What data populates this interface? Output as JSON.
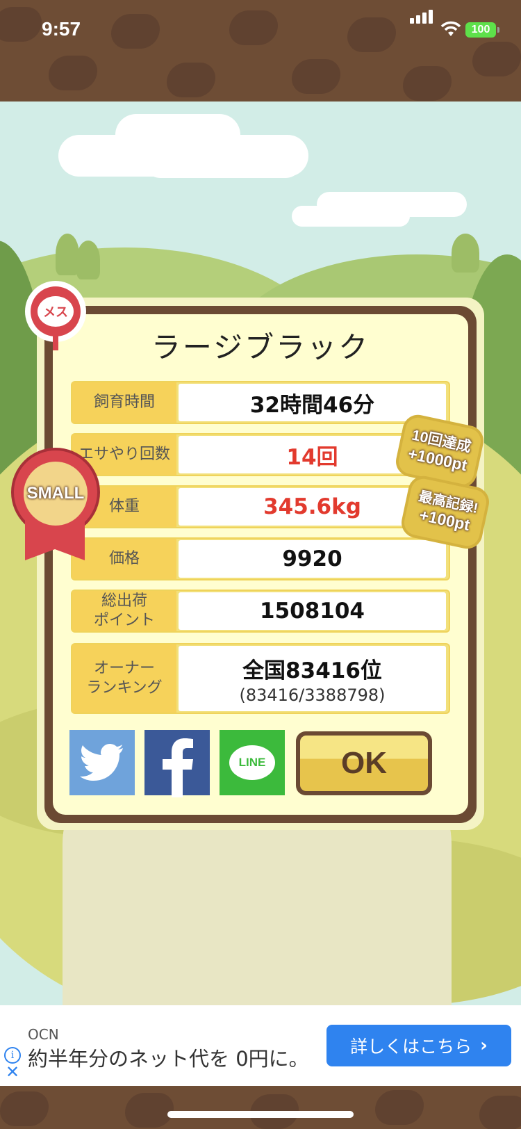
{
  "status_bar": {
    "time": "9:57",
    "battery": "100"
  },
  "sex_icon": "メス",
  "size_badge": "SMALL",
  "dialog": {
    "title": "ラージブラック",
    "rows": [
      {
        "label": "飼育時間",
        "value": "32時間46分",
        "value_color": "#111111"
      },
      {
        "label": "エサやり回数",
        "value": "14回",
        "value_color": "#e23a2e"
      },
      {
        "label": "体重",
        "value": "345.6kg",
        "value_color": "#e23a2e"
      },
      {
        "label": "価格",
        "value": "9920",
        "value_color": "#111111"
      },
      {
        "label": "総出荷\nポイント",
        "value": "1508104",
        "value_color": "#111111"
      }
    ],
    "ranking": {
      "label": "オーナー\nランキング",
      "main": "全国83416位",
      "sub": "(83416/3388798)"
    },
    "bonus_1": {
      "line1": "10回達成",
      "line2": "+1000pt"
    },
    "bonus_2": {
      "line1": "最高記録!",
      "line2": "+100pt"
    },
    "share": {
      "twitter_color": "#6fa3db",
      "facebook_color": "#3b5998",
      "line_color": "#3cba3c",
      "line_label": "LINE"
    },
    "ok_label": "OK"
  },
  "ad": {
    "brand": "OCN",
    "text": "約半年分のネット代を 0円に。",
    "button": "詳しくはこちら"
  }
}
